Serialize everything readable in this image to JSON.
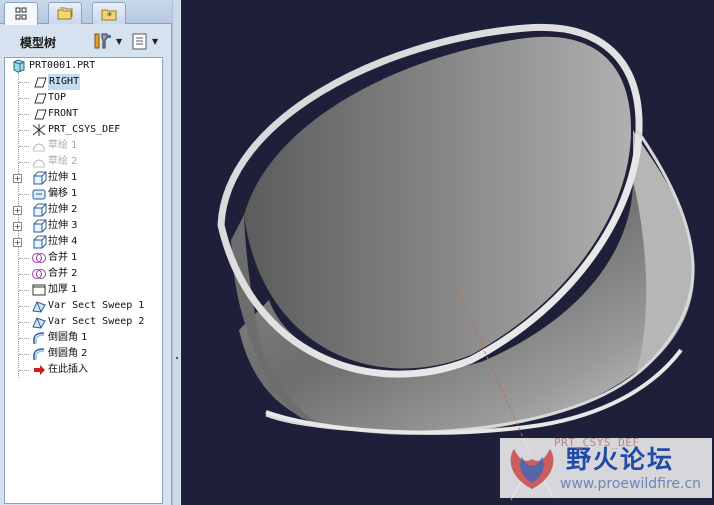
{
  "tabs": [
    {
      "name": "model-tree-tab",
      "icon": "model-tree-icon"
    },
    {
      "name": "folder-browser-tab",
      "icon": "folders-icon"
    },
    {
      "name": "favorites-tab",
      "icon": "star-folder-icon"
    }
  ],
  "panel": {
    "title": "模型树",
    "settings_icon": "tools-icon",
    "show_icon": "list-settings-icon"
  },
  "tree": {
    "root": "PRT0001.PRT",
    "items": [
      {
        "label": "RIGHT",
        "icon": "datum-plane-icon",
        "selected": true
      },
      {
        "label": "TOP",
        "icon": "datum-plane-icon"
      },
      {
        "label": "FRONT",
        "icon": "datum-plane-icon"
      },
      {
        "label": "PRT_CSYS_DEF",
        "icon": "csys-icon"
      },
      {
        "label": "草绘 1",
        "icon": "sketch-icon",
        "dim": true
      },
      {
        "label": "草绘 2",
        "icon": "sketch-icon",
        "dim": true
      },
      {
        "label": "拉伸 1",
        "icon": "extrude-icon",
        "expandable": true
      },
      {
        "label": "偏移 1",
        "icon": "offset-icon"
      },
      {
        "label": "拉伸 2",
        "icon": "extrude-icon",
        "expandable": true
      },
      {
        "label": "拉伸 3",
        "icon": "extrude-icon",
        "expandable": true
      },
      {
        "label": "拉伸 4",
        "icon": "extrude-icon",
        "expandable": true
      },
      {
        "label": "合并 1",
        "icon": "merge-icon"
      },
      {
        "label": "合并 2",
        "icon": "merge-icon"
      },
      {
        "label": "加厚 1",
        "icon": "thicken-icon"
      },
      {
        "label": "Var Sect Sweep 1",
        "icon": "var-sect-sweep-icon"
      },
      {
        "label": "Var Sect Sweep 2",
        "icon": "var-sect-sweep-icon"
      },
      {
        "label": "倒圆角 1",
        "icon": "round-icon"
      },
      {
        "label": "倒圆角 2",
        "icon": "round-icon"
      },
      {
        "label": "在此插入",
        "icon": "insert-here-arrow-icon"
      }
    ]
  },
  "viewport": {
    "csys_label": "PRT_CSYS_DEF",
    "background": "#1d2038"
  },
  "watermark": {
    "title": "野火论坛",
    "url": "www.proewildfire.cn"
  }
}
